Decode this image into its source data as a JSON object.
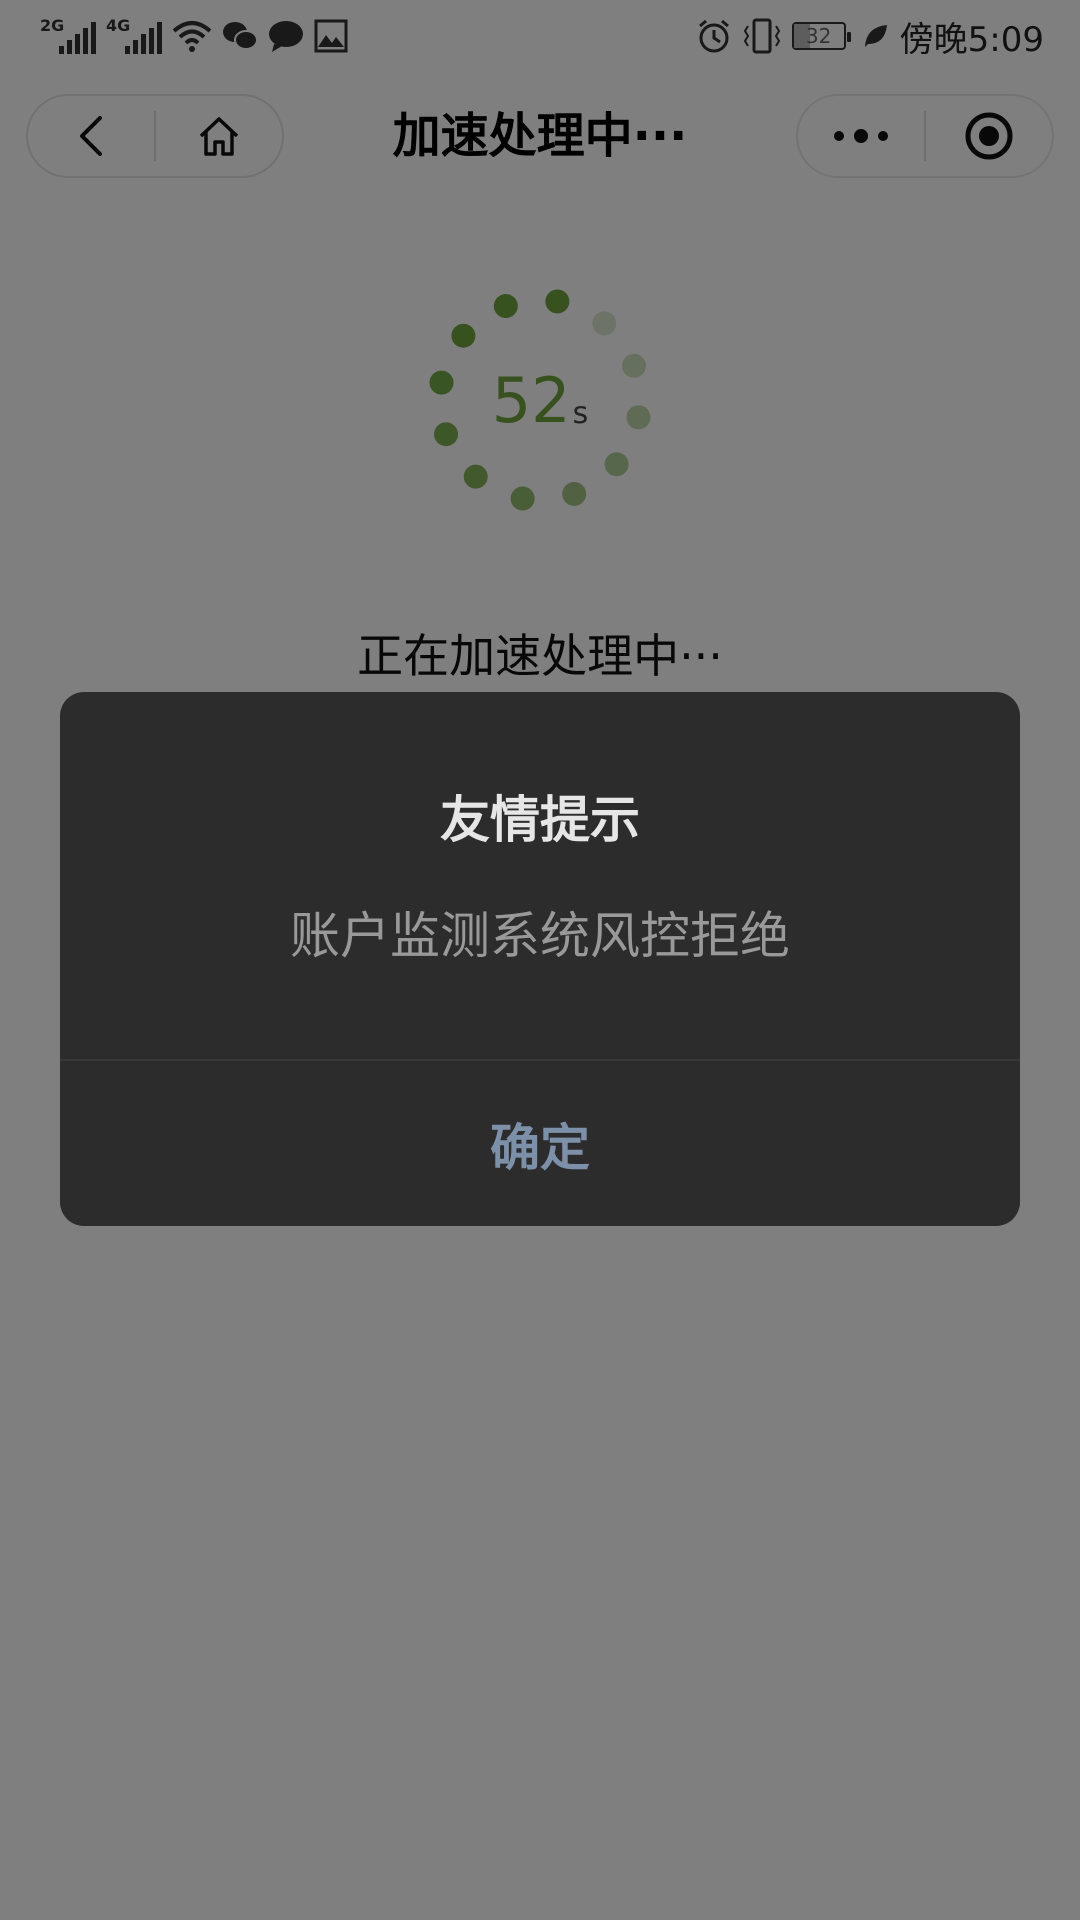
{
  "status_bar": {
    "left_icons": [
      "signal-2g-icon",
      "signal-4g-icon",
      "wifi-icon",
      "wechat-icon",
      "message-icon",
      "image-alert-icon"
    ],
    "network_1": "2G",
    "network_2": "4G",
    "battery_level": "32",
    "time_period": "傍晚",
    "time": "5:09",
    "right_icons": [
      "alarm-icon",
      "vibrate-icon",
      "battery-icon",
      "leaf-icon"
    ]
  },
  "nav": {
    "title": "加速处理中···",
    "back_icon": "back-arrow-icon",
    "home_icon": "home-icon",
    "more_icon": "more-dots-icon",
    "close_icon": "target-circle-icon"
  },
  "countdown": {
    "value": "52",
    "unit": "s",
    "accent_color": "#6ea53f"
  },
  "processing_text": "正在加速处理中···",
  "dialog": {
    "title": "友情提示",
    "message": "账户监测系统风控拒绝",
    "confirm_label": "确定",
    "confirm_color": "#7d90a9"
  }
}
